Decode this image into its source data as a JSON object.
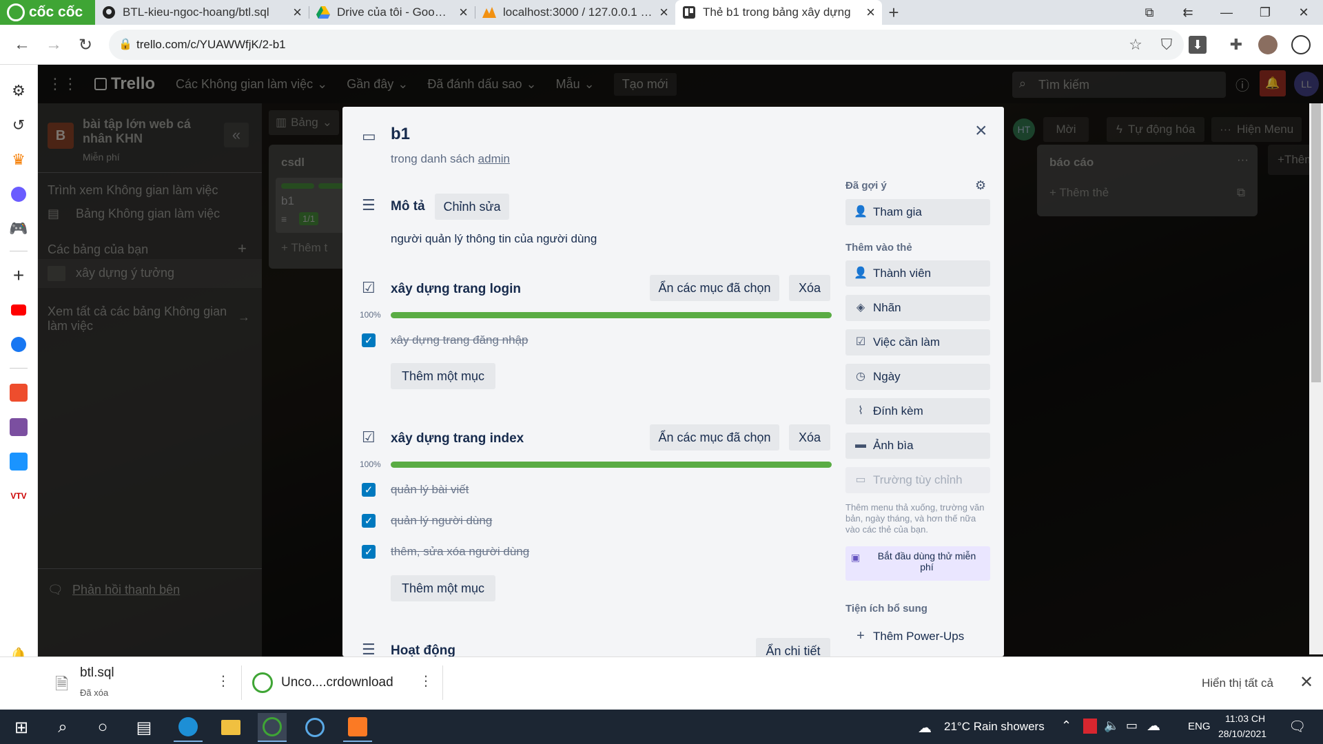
{
  "browser": {
    "name": "cốc cốc",
    "tabs": [
      {
        "label": "BTL-kieu-ngoc-hoang/btl.sql",
        "icon": "github-icon"
      },
      {
        "label": "Drive của tôi - Google Drive",
        "icon": "google-drive-icon"
      },
      {
        "label": "localhost:3000 / 127.0.0.1 / b",
        "icon": "phpmyadmin-icon"
      },
      {
        "label": "Thẻ b1 trong bảng xây dựng",
        "icon": "trello-icon",
        "active": true
      }
    ],
    "url": "trello.com/c/YUAWWfjK/2-b1"
  },
  "trello_nav": {
    "logo": "Trello",
    "items": [
      "Các Không gian làm việc",
      "Gần đây",
      "Đã đánh dấu sao",
      "Mẫu"
    ],
    "create": "Tạo mới",
    "search_placeholder": "Tìm kiếm",
    "avatar": "LL"
  },
  "workspace": {
    "initial": "B",
    "name": "bài tập lớn web cá nhân KHN",
    "plan": "Miễn phí",
    "view_heading": "Trình xem Không gian làm việc",
    "table_view": "Bảng Không gian làm việc",
    "your_boards": "Các bảng của bạn",
    "board_name": "xây dựng ý tưởng",
    "see_all": "Xem tất cả các bảng Không gian làm việc",
    "feedback": "Phản hồi thanh bên"
  },
  "board": {
    "view_label": "Bảng",
    "member_initials": "HT",
    "invite": "Mời",
    "automation": "Tự động hóa",
    "show_menu": "Hiện Menu",
    "lists": [
      {
        "name": "csdl",
        "card": "b1",
        "badge": "1/1",
        "add": "Thêm t"
      },
      {
        "name": "báo cáo",
        "add": "Thêm thẻ"
      }
    ],
    "add_list": "Thêm da"
  },
  "card": {
    "title": "b1",
    "in_list_prefix": "trong danh sách",
    "list_name": "admin",
    "description_heading": "Mô tả",
    "edit_label": "Chỉnh sửa",
    "description": "người quản lý thông tin của người dùng",
    "checklists": [
      {
        "title": "xây dựng trang login",
        "hide_label": "Ẩn các mục đã chọn",
        "delete_label": "Xóa",
        "percent": "100%",
        "progress": 1.0,
        "items": [
          "xây dựng trang đăng nhập"
        ],
        "add_label": "Thêm một mục"
      },
      {
        "title": "xây dựng trang index",
        "hide_label": "Ẩn các mục đã chọn",
        "delete_label": "Xóa",
        "percent": "100%",
        "progress": 1.0,
        "items": [
          "quản lý bài viết",
          "quản lý người dùng",
          "thêm, sửa xóa người dùng"
        ],
        "add_label": "Thêm một mục"
      }
    ],
    "activity_heading": "Hoạt động",
    "activity_toggle": "Ẩn chi tiết",
    "sidebar": {
      "suggested_heading": "Đã gợi ý",
      "join": "Tham gia",
      "add_to_card_heading": "Thêm vào thẻ",
      "buttons": [
        "Thành viên",
        "Nhãn",
        "Việc cần làm",
        "Ngày",
        "Đính kèm",
        "Ảnh bìa"
      ],
      "custom_fields": "Trường tùy chỉnh",
      "custom_fields_desc": "Thêm menu thả xuống, trường văn bản, ngày tháng, và hơn thế nữa vào các thẻ của bạn.",
      "trial": "Bắt đầu dùng thử miễn phí",
      "powerups_heading": "Tiện ích bổ sung",
      "add_powerups": "Thêm Power-Ups"
    }
  },
  "downloads": {
    "items": [
      {
        "name": "btl.sql",
        "status": "Đã xóa"
      },
      {
        "name": "Unco....crdownload"
      }
    ],
    "show_all": "Hiển thị tất cả"
  },
  "taskbar": {
    "weather": "21°C  Rain showers",
    "language": "ENG",
    "time": "11:03 CH",
    "date": "28/10/2021"
  },
  "colors": {
    "progress": "#5aac44",
    "checkbox": "#0079bf",
    "browser_brand": "#3fa535",
    "trial_bg": "#eae6ff"
  }
}
